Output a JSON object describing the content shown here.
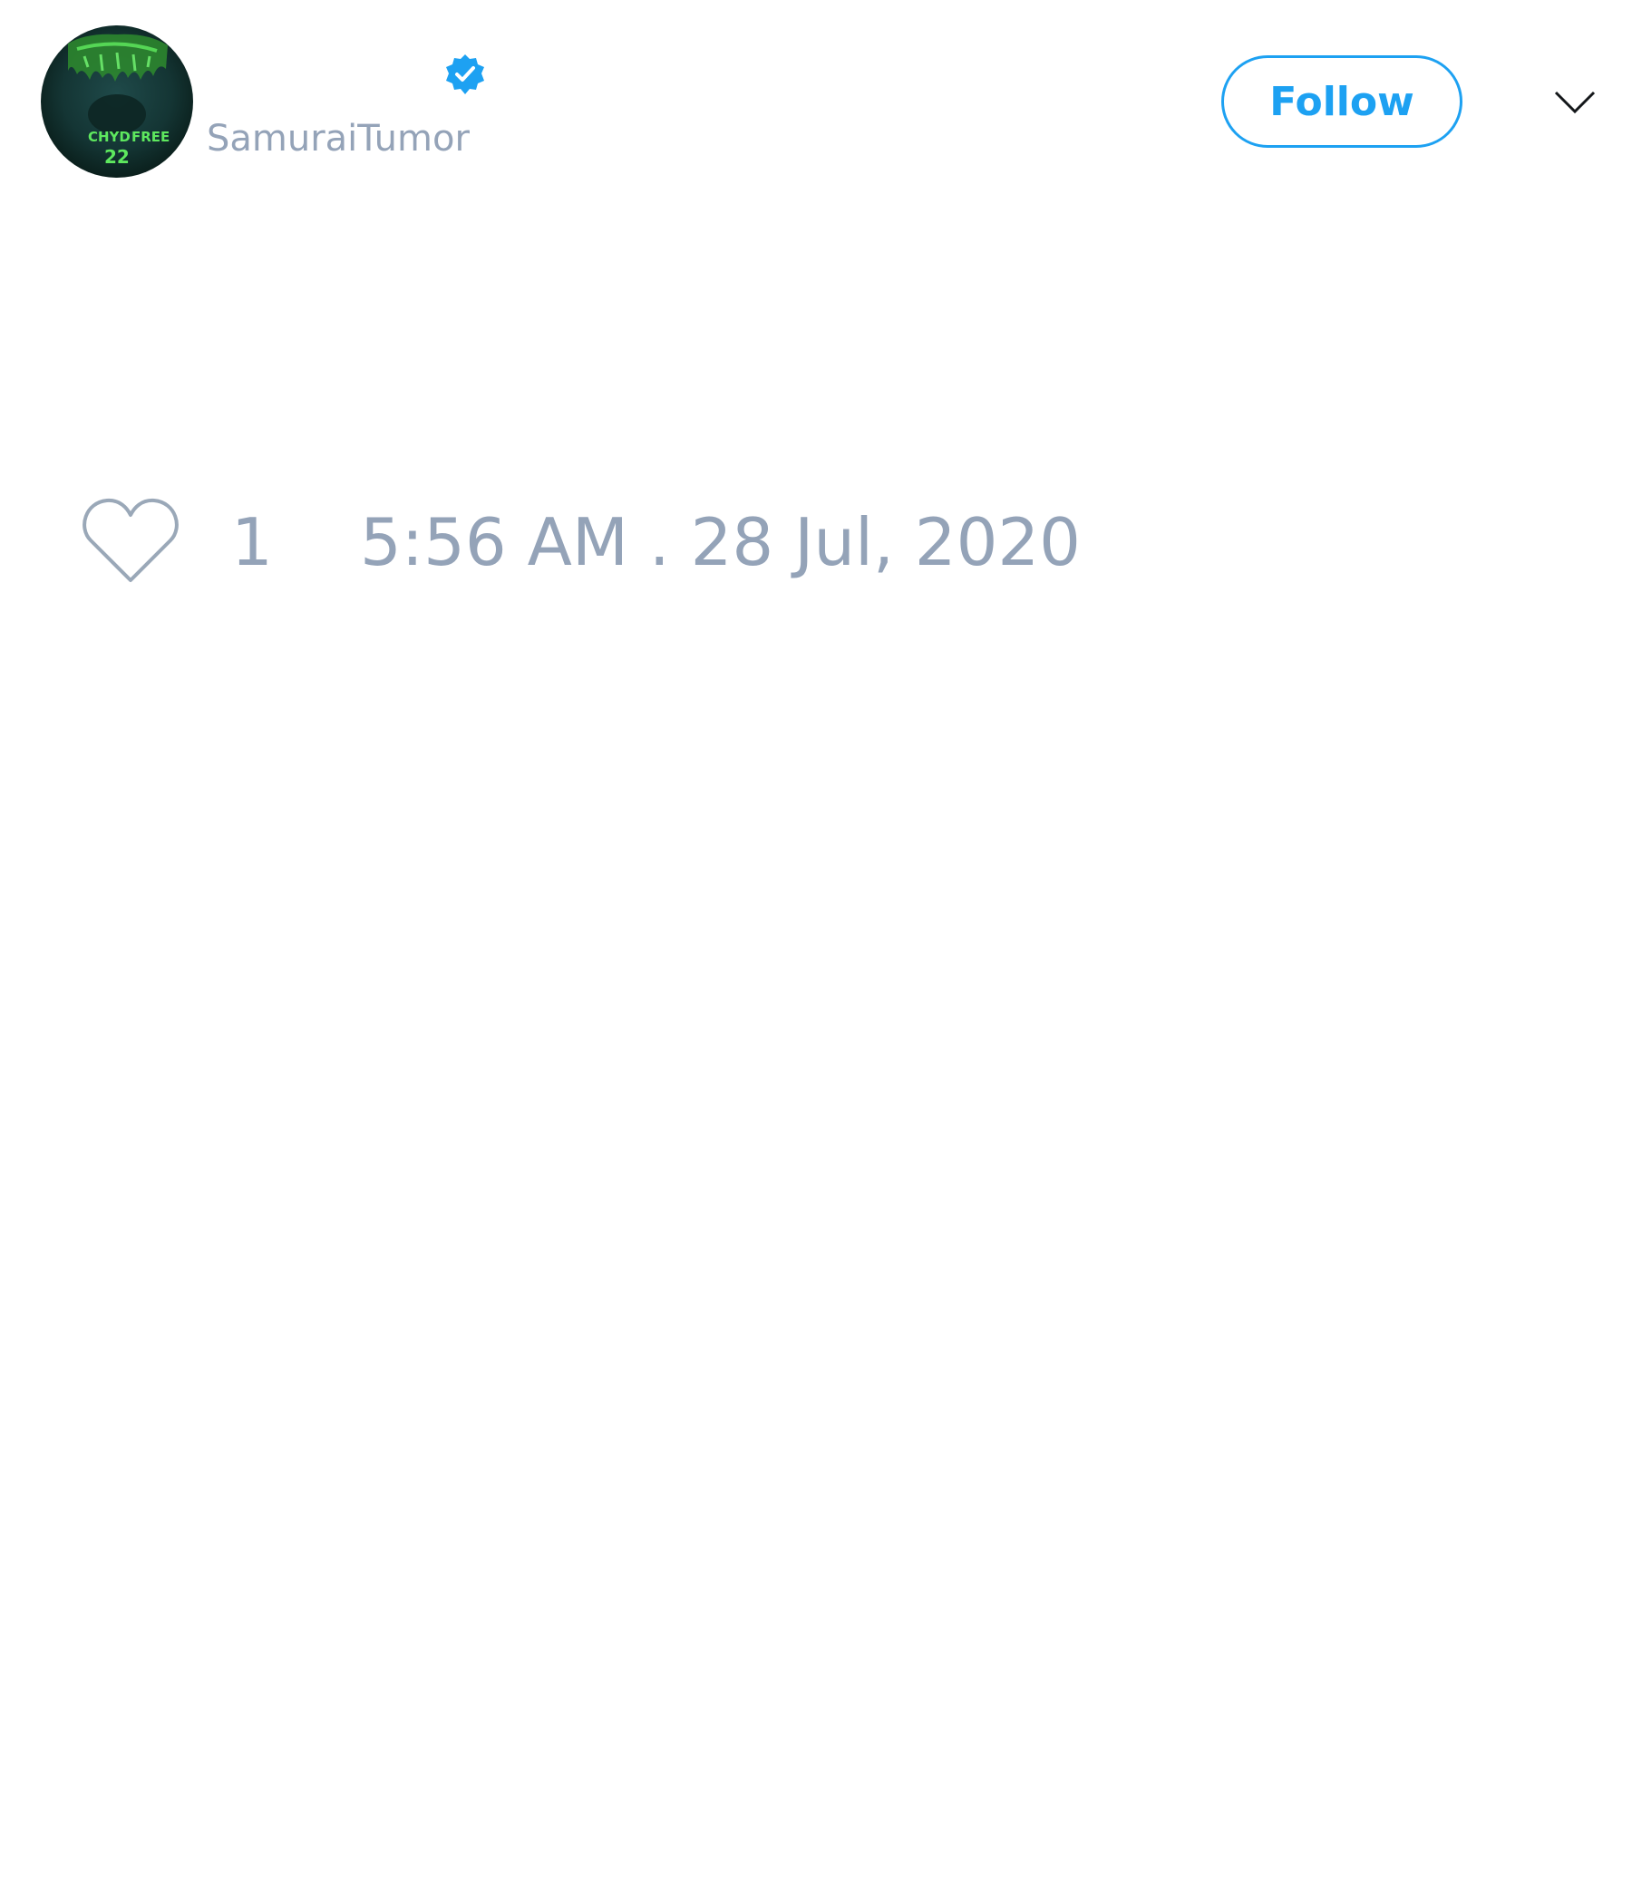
{
  "author": {
    "display_name": "",
    "handle": "SamuraiTumor",
    "verified": true,
    "avatar_icon": "avatar-image",
    "avatar_text": [
      "CHYD",
      "FREE",
      "22"
    ]
  },
  "actions": {
    "follow_label": "Follow",
    "menu_icon": "chevron-down-icon"
  },
  "engagement": {
    "like_icon": "heart-icon",
    "like_count": "1",
    "timestamp": "5:56 AM . 28 Jul, 2020"
  },
  "colors": {
    "accent": "#1da1f2",
    "muted_text": "#94a3b8",
    "background": "#ffffff"
  }
}
